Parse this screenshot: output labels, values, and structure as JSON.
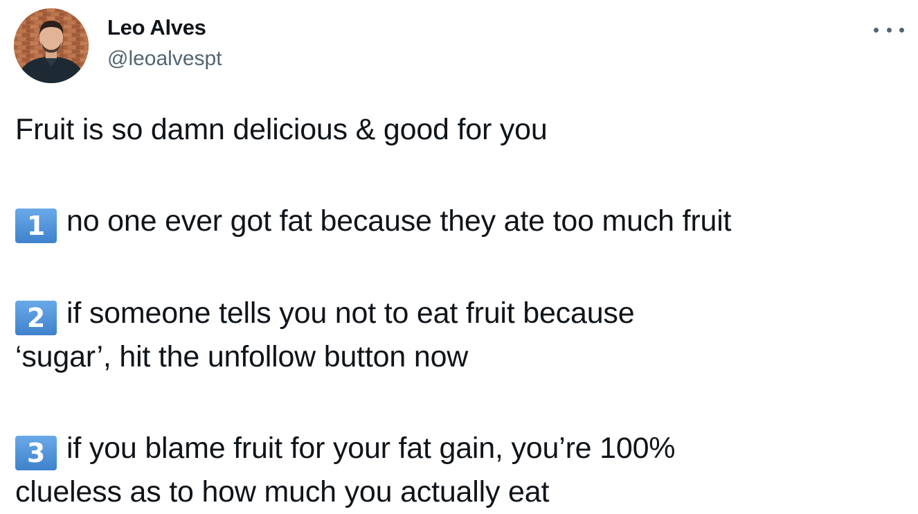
{
  "author": {
    "display_name": "Leo Alves",
    "handle": "@leoalvespt"
  },
  "more_icon": "more-horizontal-icon",
  "tweet": {
    "intro": "Fruit is so damn delicious & good for you",
    "points": [
      {
        "number": "1",
        "line1": "no one ever got fat because they ate too much fruit",
        "line2": ""
      },
      {
        "number": "2",
        "line1": "if someone tells you not to eat fruit because",
        "line2": "‘sugar’, hit the unfollow button now"
      },
      {
        "number": "3",
        "line1": "if you blame fruit for your fat gain, you’re 100%",
        "line2": "clueless as to how much you actually eat"
      }
    ]
  },
  "colors": {
    "text": "#0f1419",
    "secondary_text": "#536471",
    "keycap": "#4a8fd6"
  }
}
